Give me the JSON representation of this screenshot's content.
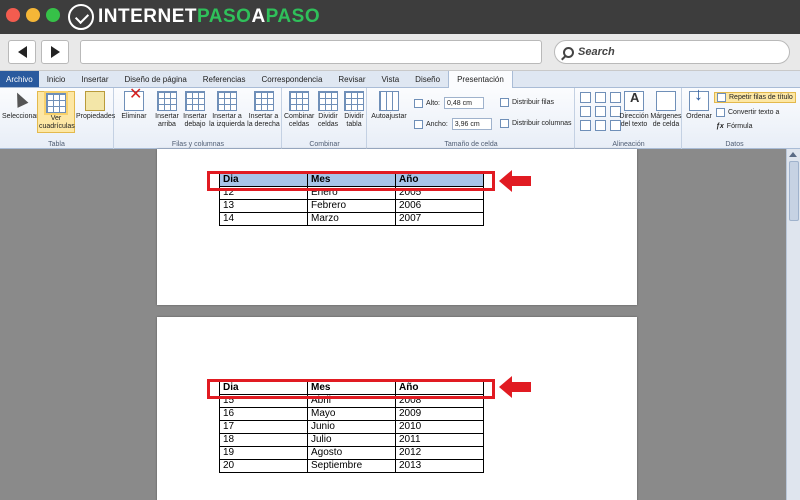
{
  "brand": {
    "part1": "INTERNET",
    "part2": "PASO",
    "part3": "A",
    "part4": "PASO"
  },
  "browser": {
    "search_placeholder": "Search"
  },
  "ribbon": {
    "tabs": [
      "Archivo",
      "Inicio",
      "Insertar",
      "Diseño de página",
      "Referencias",
      "Correspondencia",
      "Revisar",
      "Vista",
      "Diseño",
      "Presentación"
    ],
    "active_tab": "Presentación",
    "groups": {
      "tabla": {
        "label": "Tabla",
        "seleccionar": "Seleccionar",
        "ver_cuadriculas_1": "Ver",
        "ver_cuadriculas_2": "cuadrículas",
        "propiedades": "Propiedades"
      },
      "filas": {
        "label": "Filas y columnas",
        "eliminar": "Eliminar",
        "ins_arriba_1": "Insertar",
        "ins_arriba_2": "arriba",
        "ins_debajo_1": "Insertar",
        "ins_debajo_2": "debajo",
        "ins_izq_1": "Insertar a",
        "ins_izq_2": "la izquierda",
        "ins_der_1": "Insertar a",
        "ins_der_2": "la derecha"
      },
      "combinar": {
        "label": "Combinar",
        "comb_celdas_1": "Combinar",
        "comb_celdas_2": "celdas",
        "div_celdas_1": "Dividir",
        "div_celdas_2": "celdas",
        "div_tabla_1": "Dividir",
        "div_tabla_2": "tabla"
      },
      "tamano": {
        "label": "Tamaño de celda",
        "autoajustar": "Autoajustar",
        "alto_label": "Alto:",
        "alto_value": "0,48 cm",
        "ancho_label": "Ancho:",
        "ancho_value": "3,96 cm",
        "distribuir_filas": "Distribuir filas",
        "distribuir_columnas": "Distribuir columnas"
      },
      "alineacion": {
        "label": "Alineación",
        "direccion_1": "Dirección",
        "direccion_2": "del texto",
        "margenes_1": "Márgenes",
        "margenes_2": "de celda"
      },
      "datos": {
        "label": "Datos",
        "ordenar": "Ordenar",
        "repetir": "Repetir filas de título",
        "convertir": "Convertir texto a",
        "formula": "Fórmula"
      }
    }
  },
  "document": {
    "headers": [
      "Dia",
      "Mes",
      "Año"
    ],
    "page1_rows": [
      [
        "12",
        "Enero",
        "2005"
      ],
      [
        "13",
        "Febrero",
        "2006"
      ],
      [
        "14",
        "Marzo",
        "2007"
      ]
    ],
    "page2_rows": [
      [
        "15",
        "Abril",
        "2008"
      ],
      [
        "16",
        "Mayo",
        "2009"
      ],
      [
        "17",
        "Junio",
        "2010"
      ],
      [
        "18",
        "Julio",
        "2011"
      ],
      [
        "19",
        "Agosto",
        "2012"
      ],
      [
        "20",
        "Septiembre",
        "2013"
      ]
    ]
  },
  "colors": {
    "annotation_red": "#e11b22",
    "selected_header": "#a8c4e8",
    "brand_green": "#2fc05a"
  }
}
